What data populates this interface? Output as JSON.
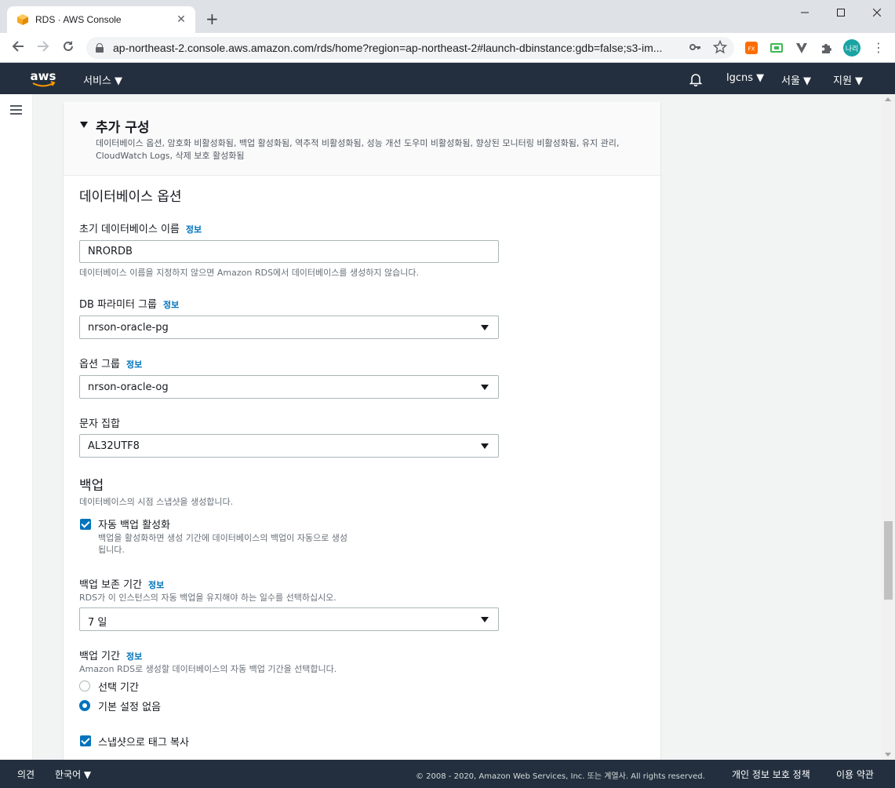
{
  "browser": {
    "tab_title": "RDS · AWS Console",
    "url": "ap-northeast-2.console.aws.amazon.com/rds/home?region=ap-northeast-2#launch-dbinstance:gdb=false;s3-im...",
    "profile_initials": "나리",
    "new_tab_glyph": "+",
    "close_glyph": "✕"
  },
  "aws_nav": {
    "logo_text": "aws",
    "services_label": "서비스 ▼",
    "account_label": "lgcns ▼",
    "region_label": "서울 ▼",
    "support_label": "지원 ▼"
  },
  "panel": {
    "title": "추가 구성",
    "description": "데이터베이스 옵션, 암호화 비활성화됨, 백업 활성화됨, 역추적 비활성화됨, 성능 개선 도우미 비활성화됨, 향상된 모니터링 비활성화됨, 유지 관리, CloudWatch Logs, 삭제 보호 활성화됨"
  },
  "db_options": {
    "section_title": "데이터베이스 옵션",
    "info_label": "정보",
    "initial_db_name": {
      "label": "초기 데이터베이스 이름",
      "value": "NRORDB",
      "hint": "데이터베이스 이름을 지정하지 않으면 Amazon RDS에서 데이터베이스를 생성하지 않습니다."
    },
    "param_group": {
      "label": "DB 파라미터 그룹",
      "value": "nrson-oracle-pg"
    },
    "option_group": {
      "label": "옵션 그룹",
      "value": "nrson-oracle-og"
    },
    "charset": {
      "label": "문자 집합",
      "value": "AL32UTF8"
    }
  },
  "backup": {
    "section_title": "백업",
    "section_hint": "데이터베이스의 시점 스냅샷을 생성합니다.",
    "auto_backup": {
      "label": "자동 백업 활성화",
      "checked": true,
      "hint_line1": "백업을 활성화하면 생성 기간에 데이터베이스의 백업이 자동으로 생성",
      "hint_line2": "됩니다."
    },
    "retention": {
      "label": "백업 보존 기간",
      "hint": "RDS가 이 인스턴스의 자동 백업을 유지해야 하는 일수를 선택하십시오.",
      "value": "7 일"
    },
    "window": {
      "label": "백업 기간",
      "hint": "Amazon RDS로 생성할 데이터베이스의 자동 백업 기간을 선택합니다.",
      "options": [
        {
          "label": "선택 기간",
          "selected": false
        },
        {
          "label": "기본 설정 없음",
          "selected": true
        }
      ]
    },
    "copy_tags": {
      "label": "스냅샷으로 태그 복사",
      "checked": true
    }
  },
  "footer": {
    "feedback": "의견",
    "language": "한국어 ▼",
    "copyright": "© 2008 - 2020, Amazon Web Services, Inc. 또는 계열사. All rights reserved.",
    "privacy": "개인 정보 보호 정책",
    "terms": "이용 약관"
  },
  "colors": {
    "nav_bg": "#232f3e",
    "link": "#0073bb",
    "aws_orange": "#ff9900"
  }
}
